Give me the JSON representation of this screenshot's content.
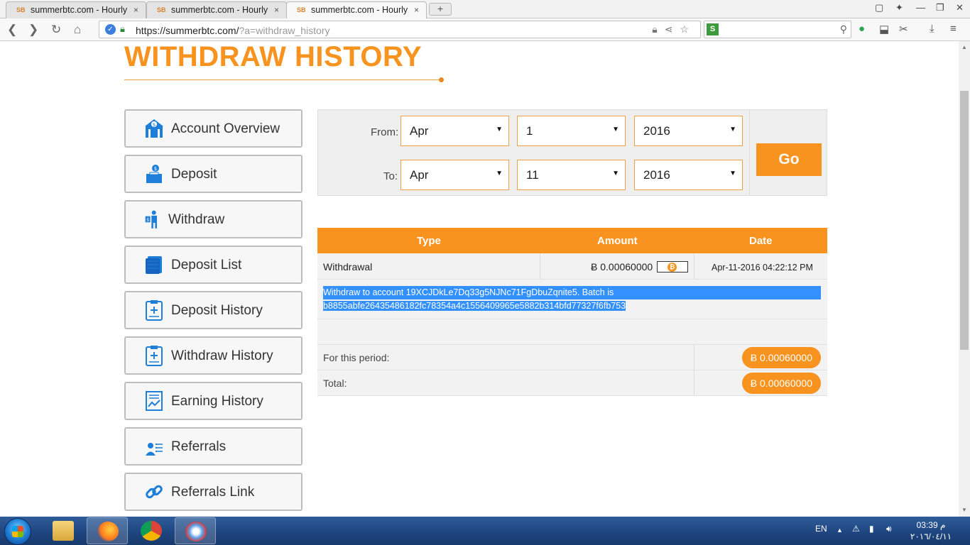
{
  "browser": {
    "tabs": [
      {
        "title": "summerbtc.com - Hourly"
      },
      {
        "title": "summerbtc.com - Hourly"
      },
      {
        "title": "summerbtc.com - Hourly"
      }
    ],
    "tab_close_icon": "×",
    "new_tab_icon": "+",
    "url_host": "https://summerbtc.com/",
    "url_query": "?a=withdraw_history"
  },
  "page": {
    "title": "WITHDRAW HISTORY"
  },
  "sidebar": {
    "items": [
      {
        "label": "Account Overview"
      },
      {
        "label": "Deposit"
      },
      {
        "label": "Withdraw"
      },
      {
        "label": "Deposit List"
      },
      {
        "label": "Deposit History"
      },
      {
        "label": "Withdraw History"
      },
      {
        "label": "Earning History"
      },
      {
        "label": "Referrals"
      },
      {
        "label": "Referrals Link"
      }
    ]
  },
  "filter": {
    "from_label": "From:",
    "to_label": "To:",
    "from_month": "Apr",
    "from_day": "1",
    "from_year": "2016",
    "to_month": "Apr",
    "to_day": "11",
    "to_year": "2016",
    "go_label": "Go"
  },
  "table": {
    "headers": {
      "type": "Type",
      "amount": "Amount",
      "date": "Date"
    },
    "rows": [
      {
        "type": "Withdrawal",
        "amount": "Ƀ 0.00060000",
        "date": "Apr-11-2016 04:22:12 PM",
        "description_line1": "Withdraw to account 19XCJDkLe7Dq33g5NJNc71FgDbuZqnite5. Batch is",
        "description_line2": "b8855abfe26435486182fc78354a4c1556409965e5882b314bfd77327f6fb753"
      }
    ],
    "period_label": "For this period:",
    "period_value": "Ƀ 0.00060000",
    "total_label": "Total:",
    "total_value": "Ƀ 0.00060000"
  },
  "taskbar": {
    "language": "EN",
    "clock_time": "03:39 م",
    "clock_date": "٢٠١٦/٠٤/١١"
  },
  "colors": {
    "accent": "#f7931e",
    "selection": "#3390ff",
    "icon_blue": "#1e7fd9"
  }
}
